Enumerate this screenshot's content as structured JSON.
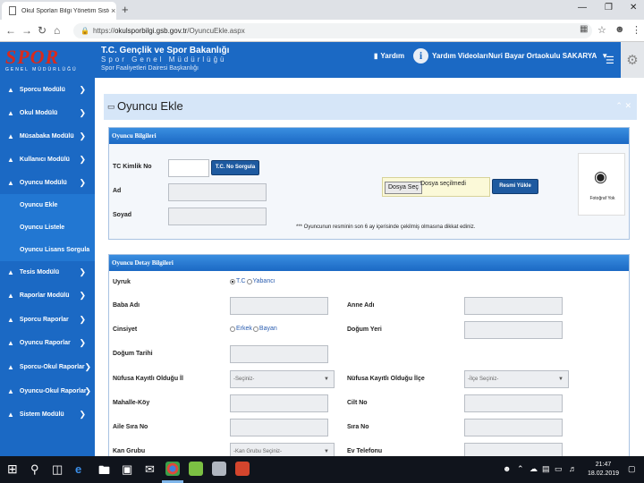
{
  "browser": {
    "tab_title": "Okul Sporları Bilgi Yönetim Siste",
    "tab_close": "×",
    "new_tab": "+",
    "url_prefix": "https://",
    "url_domain": "okulsporbilgi.gsb.gov.tr",
    "url_path": "/OyuncuEkle.aspx"
  },
  "header": {
    "logo_text": "SPOR",
    "logo_sub": "GENEL MÜDÜRLÜĞÜ",
    "org_title": "T.C. Gençlik ve Spor Bakanlığı",
    "org_sub1": "Spor Genel Müdürlüğü",
    "org_sub2": "Spor Faaliyetleri Dairesi Başkanlığı",
    "help_label": "Yardım",
    "help_videos_label": "Yardım Videoları",
    "info_glyph": "i",
    "user_label": "Nuri Bayar Ortaokulu SAKARYA"
  },
  "sidebar": {
    "items": [
      {
        "label": "Sporcu Modülü"
      },
      {
        "label": "Okul Modülü"
      },
      {
        "label": "Müsabaka Modülü"
      },
      {
        "label": "Kullanıcı Modülü"
      },
      {
        "label": "Oyuncu Modülü"
      },
      {
        "label": "Tesis Modülü"
      },
      {
        "label": "Raporlar Modülü"
      },
      {
        "label": "Sporcu Raporlar"
      },
      {
        "label": "Oyuncu Raporlar"
      },
      {
        "label": "Sporcu-Okul Raporlar"
      },
      {
        "label": "Oyuncu-Okul Raporlar"
      },
      {
        "label": "Sistem Modülü"
      }
    ],
    "subitems": [
      {
        "label": "Oyuncu Ekle"
      },
      {
        "label": "Oyuncu Listele"
      },
      {
        "label": "Oyuncu Lisans Sorgula"
      }
    ]
  },
  "page": {
    "title": "Oyuncu Ekle"
  },
  "player_info": {
    "header": "Oyuncu Bilgileri",
    "tc_label": "TC Kimlik No",
    "tc_value": "",
    "tc_query_button": "T.C. No Sorgula",
    "name_label": "Ad",
    "surname_label": "Soyad",
    "file_button": "Dosya Seç",
    "file_status": "Dosya seçilmedi",
    "upload_button": "Resmi Yükle",
    "photo_label": "Fotoğraf Yok",
    "photo_note": "*** Oyuncunun resminin son 6 ay içerisinde çekilmiş olmasına dikkat ediniz."
  },
  "details": {
    "header": "Oyuncu Detay Bilgileri",
    "nationality_label": "Uyruk",
    "nationality_opt1": "T.C",
    "nationality_opt2": "Yabancı",
    "father_label": "Baba Adı",
    "mother_label": "Anne Adı",
    "gender_label": "Cinsiyet",
    "gender_opt1": "Erkek",
    "gender_opt2": "Bayan",
    "birthplace_label": "Doğum Yeri",
    "birthdate_label": "Doğum Tarihi",
    "reg_city_label": "Nüfusa Kayıtlı Olduğu İl",
    "reg_city_placeholder": "-Seçiniz-",
    "reg_district_label": "Nüfusa Kayıtlı Olduğu İlçe",
    "reg_district_placeholder": "-İlçe Seçiniz-",
    "neighborhood_label": "Mahalle-Köy",
    "volume_label": "Cilt No",
    "family_seq_label": "Aile Sıra No",
    "seq_label": "Sıra No",
    "blood_label": "Kan Grubu",
    "blood_placeholder": "-Kan Grubu Seçiniz-",
    "home_phone_label": "Ev Telefonu"
  },
  "taskbar": {
    "time": "21:47",
    "date": "18.02.2019"
  },
  "colors": {
    "brand_blue": "#1b69c4",
    "logo_red": "#d92a1c",
    "button_navy": "#1e5aa0"
  }
}
